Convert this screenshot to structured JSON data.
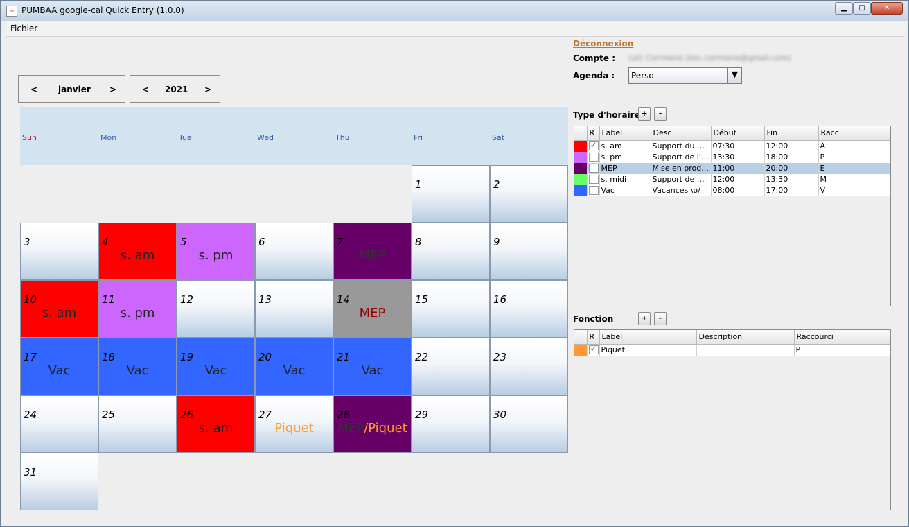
{
  "window": {
    "title": "PUMBAA google-cal Quick Entry (1.0.0)",
    "controls": {
      "minimize": "▁",
      "maximize": "□",
      "close": "✕"
    }
  },
  "menubar": {
    "items": [
      "Fichier"
    ]
  },
  "navigator": {
    "month": {
      "prev": "<",
      "value": "janvier",
      "next": ">"
    },
    "year": {
      "prev": "<",
      "value": "2021",
      "next": ">"
    }
  },
  "calendar": {
    "weekdays": [
      "Sun",
      "Mon",
      "Tue",
      "Wed",
      "Thu",
      "Fri",
      "Sat"
    ],
    "days": [
      {
        "day": "1",
        "label": ""
      },
      {
        "day": "2",
        "label": ""
      },
      {
        "day": "3",
        "label": ""
      },
      {
        "day": "4",
        "label": "s. am"
      },
      {
        "day": "5",
        "label": "s. pm"
      },
      {
        "day": "6",
        "label": ""
      },
      {
        "day": "7",
        "label": "MEP"
      },
      {
        "day": "8",
        "label": ""
      },
      {
        "day": "9",
        "label": ""
      },
      {
        "day": "10",
        "label": "s. am"
      },
      {
        "day": "11",
        "label": "s. pm"
      },
      {
        "day": "12",
        "label": ""
      },
      {
        "day": "13",
        "label": ""
      },
      {
        "day": "14",
        "label": "MEP"
      },
      {
        "day": "15",
        "label": ""
      },
      {
        "day": "16",
        "label": ""
      },
      {
        "day": "17",
        "label": "Vac"
      },
      {
        "day": "18",
        "label": "Vac"
      },
      {
        "day": "19",
        "label": "Vac"
      },
      {
        "day": "20",
        "label": "Vac"
      },
      {
        "day": "21",
        "label": "Vac"
      },
      {
        "day": "22",
        "label": ""
      },
      {
        "day": "23",
        "label": ""
      },
      {
        "day": "24",
        "label": ""
      },
      {
        "day": "25",
        "label": ""
      },
      {
        "day": "26",
        "label": "s. am"
      },
      {
        "day": "27",
        "label": "Piquet"
      },
      {
        "day": "28",
        "label": "MEP",
        "label2": "/",
        "label3": "Piquet"
      },
      {
        "day": "29",
        "label": ""
      },
      {
        "day": "30",
        "label": ""
      },
      {
        "day": "31",
        "label": ""
      }
    ]
  },
  "account": {
    "disconnect": "Déconnexion",
    "compte_label": "Compte :",
    "compte_value": "Loïc Corrmeve (loic.corrmeve@gmail.com)",
    "agenda_label": "Agenda :",
    "agenda_value": "Perso",
    "agenda_arrow": "▼"
  },
  "schedule_types": {
    "title": "Type d'horaires",
    "add": "+",
    "remove": "-",
    "columns": [
      "",
      "R",
      "Label",
      "Desc.",
      "Début",
      "Fin",
      "Racc."
    ],
    "rows": [
      {
        "color": "#ff0000",
        "r": true,
        "label": "s. am",
        "desc": "Support du m...",
        "start": "07:30",
        "end": "12:00",
        "key": "A"
      },
      {
        "color": "#cc66ff",
        "r": false,
        "label": "s. pm",
        "desc": "Support de l'a...",
        "start": "13:30",
        "end": "18:00",
        "key": "P"
      },
      {
        "color": "#660066",
        "r": false,
        "label": "MEP",
        "desc": "Mise en prod...",
        "start": "11:00",
        "end": "20:00",
        "key": "E",
        "selected": true
      },
      {
        "color": "#66ff66",
        "r": false,
        "label": "s. midi",
        "desc": "Support de m...",
        "start": "12:00",
        "end": "13:30",
        "key": "M"
      },
      {
        "color": "#3366ff",
        "r": false,
        "label": "Vac",
        "desc": "Vacances \\o/",
        "start": "08:00",
        "end": "17:00",
        "key": "V"
      }
    ]
  },
  "functions": {
    "title": "Fonction",
    "add": "+",
    "remove": "-",
    "columns": [
      "",
      "R",
      "Label",
      "Description",
      "Raccourci"
    ],
    "rows": [
      {
        "color": "#ff9933",
        "r": true,
        "label": "Piquet",
        "desc": "",
        "key": "P"
      }
    ]
  },
  "colors": {
    "s_am": "#ff0000",
    "s_pm": "#cc66ff",
    "mep": "#660066",
    "mep_today": "#999999",
    "vac": "#3366ff",
    "piquet_text": "#ff9933",
    "mep_text": "#333333",
    "mep_today_text": "#990000"
  }
}
